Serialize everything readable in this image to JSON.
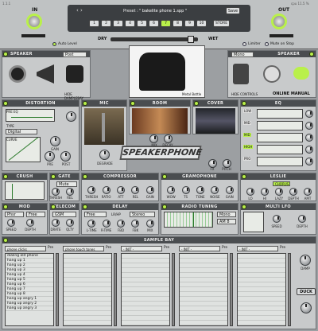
{
  "header": {
    "version_left": "1.1.1",
    "version_right": "cpu 11.5 %",
    "in_label": "IN",
    "out_label": "OUT",
    "preset_label": "Preset :",
    "preset_name": "\" bakelite phone 1.spp \"",
    "save_label": "Save",
    "store_label": "STORE",
    "slots": [
      "1",
      "2",
      "3",
      "4",
      "5",
      "6",
      "7",
      "8",
      "9",
      "10"
    ],
    "active_slot": "7",
    "dry_label": "DRY",
    "wet_label": "WET",
    "auto_level": "Auto Level",
    "limiter": "Limiter",
    "mute_on_stop": "Mute on Stop"
  },
  "speaker_left": {
    "title": "SPEAKER",
    "mode": "Post",
    "footer": "HIDE DAMPLEBAY"
  },
  "speaker_right": {
    "title": "SPEAKER",
    "mode": "Mono",
    "footer": "HIDE CONTROLS",
    "online": "ONLINE MANUAL"
  },
  "metal_bottle": "Metal Bottle",
  "modules": {
    "distortion": "DISTORTION",
    "mic": "MIC",
    "room": "ROOM",
    "cover": "COVER",
    "eq": "EQ",
    "crush": "CRUSH",
    "gate": "GATE",
    "compressor": "COMPRESSOR",
    "gramophone": "GRAMOPHONE",
    "leslie": "LESLIE",
    "mod": "MOD",
    "telecom": "TELECOM",
    "delay": "DELAY",
    "radio": "RADIO TUNING",
    "multilfo": "MULTI LFO",
    "samplebay": "SAMPLE BAY"
  },
  "distortion": {
    "pre_eq": "PRE EQ",
    "type": "TYPE",
    "type_value": "Digital",
    "curve": "CURVE",
    "gain": "GAIN",
    "pre": "PRE",
    "post": "POST"
  },
  "mic": {
    "degrade": "DEGRADE"
  },
  "room": {
    "mix": "MIX",
    "decay": "DECAY"
  },
  "cover": {
    "fx": "FX",
    "pitch": "PITCH"
  },
  "eq": {
    "bands": [
      "LOW",
      "MID",
      "MID",
      "HIGH",
      "PRO"
    ]
  },
  "gate": {
    "mode": "Mute",
    "thresh": "THRESH",
    "rel": "REL"
  },
  "compressor": {
    "knobs": [
      "THRESH",
      "RATIO",
      "ATT",
      "REL",
      "GAIN"
    ]
  },
  "gramophone": {
    "knobs": [
      "WOW",
      "TS",
      "TONE",
      "NOISE",
      "GAIN"
    ]
  },
  "leslie": {
    "mode": "CHORUS",
    "knobs": [
      "LO",
      "HI",
      "LAZY",
      "DEPTH",
      "AMT"
    ]
  },
  "mod": {
    "mode": "Phsr",
    "mode2": "Free",
    "knobs": [
      "SPEED",
      "DEPTH"
    ]
  },
  "telecom": {
    "mode": "GSM",
    "knobs": [
      "DRATE",
      "QLTY"
    ]
  },
  "delay": {
    "mode": "Free",
    "sync": "Stereo",
    "lr": "LR/HP",
    "knobs": [
      "L-TIME",
      "R-TIME",
      "FBD",
      "FBK",
      "MIX"
    ]
  },
  "radio": {
    "mode": "Mono",
    "band": "AM 8",
    "knobs": [
      "TUNE",
      "VOL",
      "MIX"
    ]
  },
  "multilfo": {
    "knobs": [
      "SPEED",
      "DEPTH"
    ]
  },
  "samplebay": {
    "columns": [
      {
        "name": "phone clicks",
        "mode": "Pre"
      },
      {
        "name": "phone touch tones",
        "mode": "Pre"
      },
      {
        "name": "- INIT -",
        "mode": "Pre"
      },
      {
        "name": "- INIT -",
        "mode": "Pre"
      },
      {
        "name": "- INIT -",
        "mode": "Pre"
      }
    ],
    "first_list": [
      "dialing old phone",
      "hang up 1",
      "hang up 2",
      "hang up 3",
      "hang up 4",
      "hang up 5",
      "hang up 6",
      "hang up 7",
      "hang up 8",
      "hang up angry 1",
      "hang up angry 2",
      "hang up angry 3"
    ],
    "damp": "DAMP",
    "duck": "DUCK"
  },
  "colors": {
    "led": "#b9f04a",
    "panel": "#c8cacb",
    "header": "#4a4d50"
  }
}
